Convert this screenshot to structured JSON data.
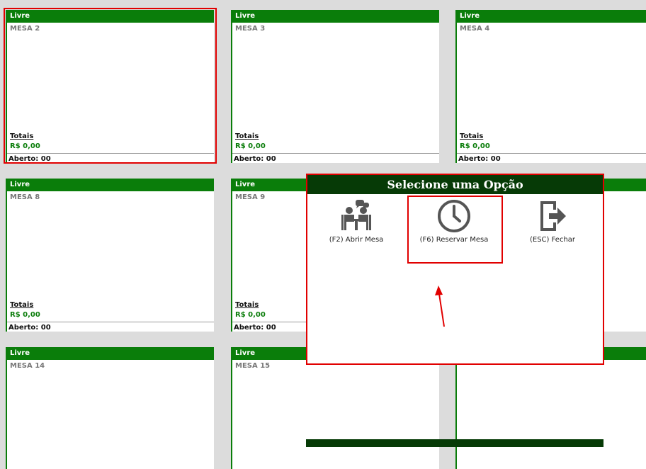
{
  "tables": [
    {
      "status": "Livre",
      "name": "MESA 2",
      "totals_label": "Totais",
      "total_value": "R$ 0,00",
      "open_label": "Aberto: 00"
    },
    {
      "status": "Livre",
      "name": "MESA 3",
      "totals_label": "Totais",
      "total_value": "R$ 0,00",
      "open_label": "Aberto: 00"
    },
    {
      "status": "Livre",
      "name": "MESA 4",
      "totals_label": "Totais",
      "total_value": "R$ 0,00",
      "open_label": "Aberto: 00"
    },
    {
      "status": "Livre",
      "name": "MESA 8",
      "totals_label": "Totais",
      "total_value": "R$ 0,00",
      "open_label": "Aberto: 00"
    },
    {
      "status": "Livre",
      "name": "MESA 9",
      "totals_label": "Totais",
      "total_value": "R$ 0,00",
      "open_label": "Aberto: 00"
    },
    {
      "status": "Livre",
      "name": "MESA 14"
    },
    {
      "status": "Livre",
      "name": "MESA 15"
    }
  ],
  "dialog": {
    "title": "Selecione uma Opção",
    "options": [
      {
        "label": "(F2) Abrir Mesa",
        "icon": "meeting-people-icon"
      },
      {
        "label": "(F6) Reservar Mesa",
        "icon": "clock-icon"
      },
      {
        "label": "(ESC) Fechar",
        "icon": "exit-icon"
      }
    ]
  },
  "colors": {
    "card_header": "#0a7d0a",
    "dialog_header": "#063a06",
    "highlight": "#e10000",
    "value_text": "#0a7d0a"
  }
}
